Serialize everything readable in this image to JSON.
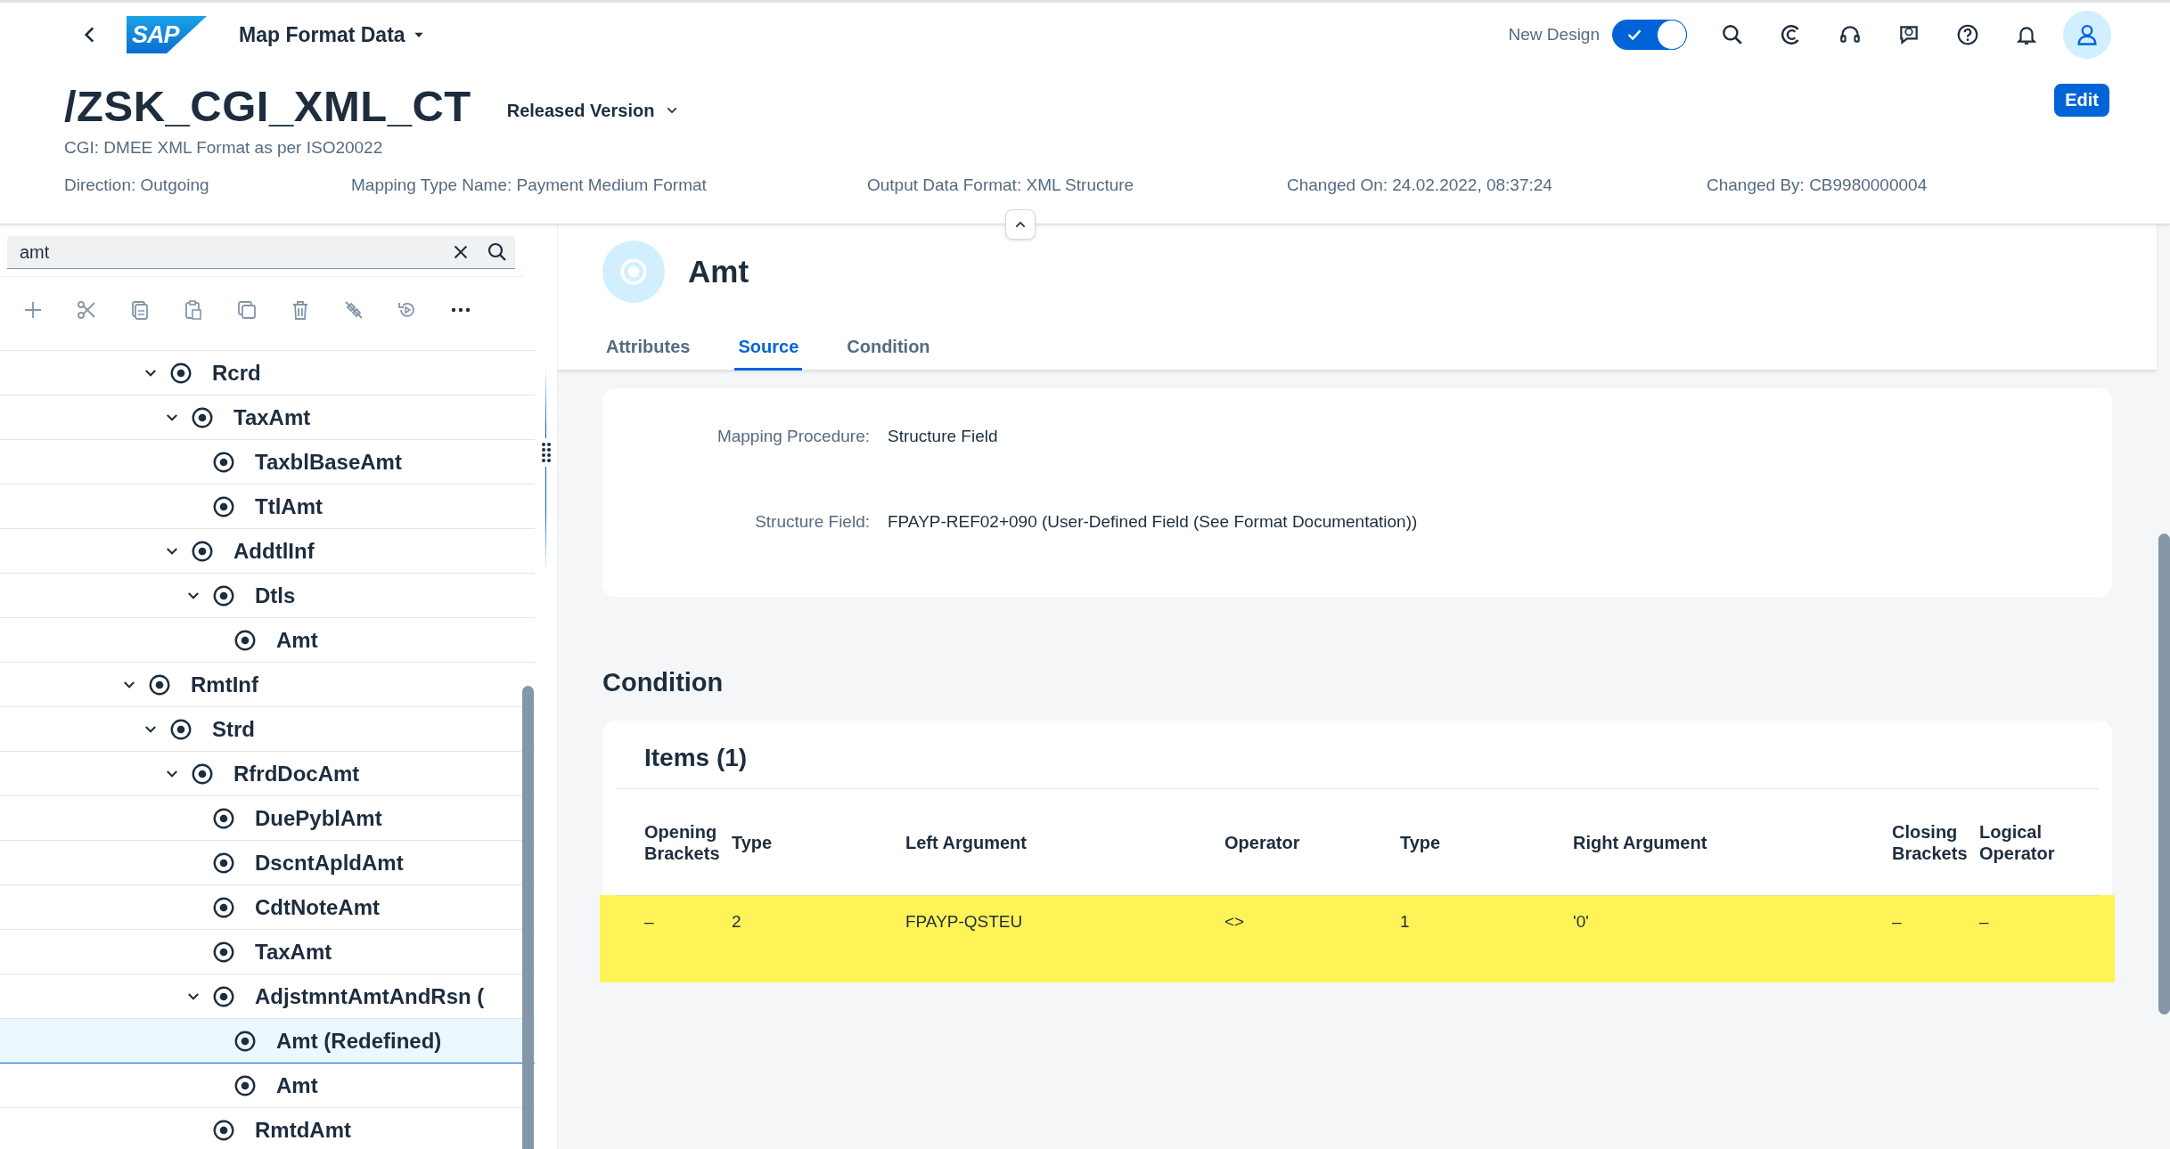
{
  "shell_bar": {
    "logo_text": "SAP",
    "app_title": "Map Format Data",
    "new_design_label": "New Design",
    "new_design_on": true
  },
  "object_header": {
    "title": "/ZSK_CGI_XML_CT",
    "version": "Released Version",
    "description": "CGI: DMEE XML Format as per ISO20022",
    "edit_button": "Edit",
    "attributes": [
      "Direction: Outgoing",
      "Mapping Type Name: Payment Medium Format",
      "Output Data Format: XML Structure",
      "Changed On: 24.02.2022, 08:37:24",
      "Changed By: CB9980000004"
    ]
  },
  "tree_panel": {
    "search": {
      "value": "amt"
    },
    "tree": [
      {
        "children": [
          {
            "label": "Rcrd",
            "expanded": true,
            "selected": false,
            "children": [
              {
                "label": "TaxAmt",
                "expanded": true,
                "selected": false,
                "children": [
                  {
                    "label": "TaxblBaseAmt",
                    "selected": false
                  },
                  {
                    "label": "TtlAmt",
                    "selected": false
                  }
                ]
              },
              {
                "label": "AddtlInf",
                "expanded": true,
                "selected": false,
                "children": [
                  {
                    "label": "Dtls",
                    "expanded": true,
                    "selected": false,
                    "children": [
                      {
                        "label": "Amt",
                        "selected": false
                      }
                    ]
                  }
                ]
              }
            ]
          }
        ]
      },
      {
        "label": "RmtInf",
        "expanded": true,
        "selected": false,
        "children": [
          {
            "label": "Strd",
            "expanded": true,
            "selected": false,
            "children": [
              {
                "label": "RfrdDocAmt",
                "expanded": true,
                "selected": false,
                "children": [
                  {
                    "label": "DuePyblAmt",
                    "selected": false
                  },
                  {
                    "label": "DscntApldAmt",
                    "selected": false
                  },
                  {
                    "label": "CdtNoteAmt",
                    "selected": false
                  },
                  {
                    "label": "TaxAmt",
                    "selected": false
                  },
                  {
                    "label": "AdjstmntAmtAndRsn (",
                    "expanded": true,
                    "selected": false,
                    "children": [
                      {
                        "label": "Amt (Redefined)",
                        "selected": true
                      },
                      {
                        "label": "Amt",
                        "selected": false
                      }
                    ]
                  },
                  {
                    "label": "RmtdAmt",
                    "selected": false
                  }
                ]
              }
            ]
          }
        ]
      }
    ]
  },
  "detail": {
    "title": "Amt",
    "tabs": [
      {
        "label": "Attributes",
        "selected": false
      },
      {
        "label": "Source",
        "selected": true
      },
      {
        "label": "Condition",
        "selected": false
      }
    ],
    "source_fields": [
      {
        "label": "Mapping Procedure:",
        "value": "Structure Field"
      },
      {
        "label": "Structure Field:",
        "value": "FPAYP-REF02+090 (User-Defined Field (See Format Documentation))"
      }
    ],
    "condition": {
      "heading": "Condition",
      "items_title": "Items (1)",
      "columns": [
        "Opening Brackets",
        "Type",
        "Left Argument",
        "Operator",
        "Type",
        "Right Argument",
        "Closing Brackets",
        "Logical Operator"
      ],
      "rows": [
        {
          "cells": [
            "–",
            "2",
            "FPAYP-QSTEU",
            "<>",
            "1",
            "'0'",
            "–",
            "–"
          ],
          "highlighted": true
        }
      ]
    }
  }
}
